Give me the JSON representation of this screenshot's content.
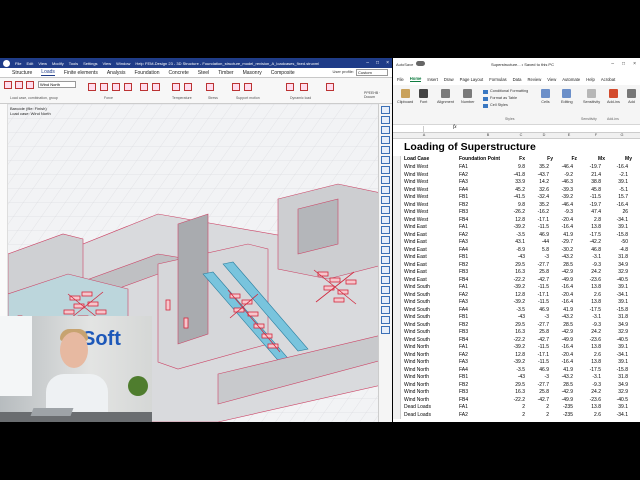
{
  "fem": {
    "title": "FEM-Design 23 - 3D Structure - Foundation_structure_model_revision_A_loadcases_fixed.struxml",
    "menu": [
      "File",
      "Edit",
      "View",
      "Modify",
      "Tools",
      "Settings",
      "View",
      "Window",
      "Help"
    ],
    "tabs": [
      "Structure",
      "Loads",
      "Finite elements",
      "Analysis",
      "Foundation",
      "Concrete",
      "Steel",
      "Timber",
      "Masonry",
      "Composite"
    ],
    "active_tab": "Loads",
    "user_profile_label": "User profile:",
    "user_profile_value": "Custom",
    "load_case_combo": "Wind North",
    "ribbon_groups": [
      "Load case, combination, group",
      "Force",
      "Temperature",
      "Stress",
      "Support motion",
      "Dynamic load"
    ],
    "info_line1": "Barcode (file: Finish)",
    "info_line2": "Load case: Wind North",
    "pp_label": "PPEEHB · Docum"
  },
  "webcam": {
    "logo_text": "Soft"
  },
  "excel": {
    "autosave_label": "AutoSave",
    "file_title": "Superstructure... • Saved to this PC",
    "tabs": [
      "File",
      "Home",
      "Insert",
      "Draw",
      "Page Layout",
      "Formulas",
      "Data",
      "Review",
      "View",
      "Automate",
      "Help",
      "Acrobat"
    ],
    "active_tab": "Home",
    "ribbon_buttons": [
      "Clipboard",
      "Font",
      "Alignment",
      "Number"
    ],
    "styles_items": [
      "Conditional Formatting",
      "Format as Table",
      "Cell Styles"
    ],
    "styles_group": "Styles",
    "ribbon_right": [
      "Cells",
      "Editing",
      "Sensitivity",
      "Add-ins",
      "Add"
    ],
    "ribbon_right_groups": [
      "Sensitivity",
      "Add-ins"
    ],
    "fx": "fx",
    "columns": [
      "A",
      "B",
      "C",
      "D",
      "E",
      "F",
      "G"
    ],
    "sheet_title": "Loading of Superstructure",
    "headers": [
      "Load Case",
      "Foundation Point",
      "Fx",
      "Fy",
      "Fz",
      "Mx",
      "My"
    ],
    "rows": [
      [
        "Wind West",
        "FA1",
        "9.8",
        "35.2",
        "-46.4",
        "-19.7",
        "-16.4"
      ],
      [
        "Wind West",
        "FA2",
        "-41.8",
        "-43.7",
        "-9.2",
        "21.4",
        "-2.1"
      ],
      [
        "Wind West",
        "FA3",
        "33.9",
        "14.2",
        "-46.3",
        "38.8",
        "39.1"
      ],
      [
        "Wind West",
        "FA4",
        "45.2",
        "32.6",
        "-39.3",
        "45.8",
        "-5.1"
      ],
      [
        "Wind West",
        "FB1",
        "-41.5",
        "-32.4",
        "-39.2",
        "-11.5",
        "15.7"
      ],
      [
        "Wind West",
        "FB2",
        "9.8",
        "35.2",
        "-46.4",
        "-19.7",
        "-16.4"
      ],
      [
        "Wind West",
        "FB3",
        "-26.2",
        "-16.2",
        "-9.3",
        "47.4",
        "26"
      ],
      [
        "Wind West",
        "FB4",
        "12.8",
        "-17.1",
        "-20.4",
        "2.8",
        "-34.1"
      ],
      [
        "Wind East",
        "FA1",
        "-39.2",
        "-11.5",
        "-16.4",
        "13.8",
        "39.1"
      ],
      [
        "Wind East",
        "FA2",
        "-3.5",
        "46.9",
        "41.9",
        "-17.5",
        "-15.8"
      ],
      [
        "Wind East",
        "FA3",
        "43.1",
        "-44",
        "-29.7",
        "-42.2",
        "-50"
      ],
      [
        "Wind East",
        "FA4",
        "-8.9",
        "5.8",
        "-30.2",
        "46.8",
        "-4.8"
      ],
      [
        "Wind East",
        "FB1",
        "-43",
        "-3",
        "-43.2",
        "-3.1",
        "31.8"
      ],
      [
        "Wind East",
        "FB2",
        "29.5",
        "-27.7",
        "28.5",
        "-9.3",
        "34.9"
      ],
      [
        "Wind East",
        "FB3",
        "16.3",
        "25.8",
        "-42.9",
        "24.2",
        "32.9"
      ],
      [
        "Wind East",
        "FB4",
        "-22.2",
        "-42.7",
        "-49.9",
        "-23.6",
        "-40.5"
      ],
      [
        "Wind South",
        "FA1",
        "-39.2",
        "-11.5",
        "-16.4",
        "13.8",
        "39.1"
      ],
      [
        "Wind South",
        "FA2",
        "12.8",
        "-17.1",
        "-20.4",
        "2.6",
        "-34.1"
      ],
      [
        "Wind South",
        "FA3",
        "-39.2",
        "-11.5",
        "-16.4",
        "13.8",
        "39.1"
      ],
      [
        "Wind South",
        "FA4",
        "-3.5",
        "46.9",
        "41.9",
        "-17.5",
        "-15.8"
      ],
      [
        "Wind South",
        "FB1",
        "-43",
        "-3",
        "-43.2",
        "-3.1",
        "31.8"
      ],
      [
        "Wind South",
        "FB2",
        "29.5",
        "-27.7",
        "28.5",
        "-9.3",
        "34.9"
      ],
      [
        "Wind South",
        "FB3",
        "16.3",
        "25.8",
        "-42.9",
        "24.2",
        "32.9"
      ],
      [
        "Wind South",
        "FB4",
        "-22.2",
        "-42.7",
        "-49.9",
        "-23.6",
        "-40.5"
      ],
      [
        "Wind North",
        "FA1",
        "-39.2",
        "-11.5",
        "-16.4",
        "13.8",
        "39.1"
      ],
      [
        "Wind North",
        "FA2",
        "12.8",
        "-17.1",
        "-20.4",
        "2.6",
        "-34.1"
      ],
      [
        "Wind North",
        "FA3",
        "-39.2",
        "-11.5",
        "-16.4",
        "13.8",
        "39.1"
      ],
      [
        "Wind North",
        "FA4",
        "-3.5",
        "46.9",
        "41.9",
        "-17.5",
        "-15.8"
      ],
      [
        "Wind North",
        "FB1",
        "-43",
        "-3",
        "-43.2",
        "-3.1",
        "31.8"
      ],
      [
        "Wind North",
        "FB2",
        "29.5",
        "-27.7",
        "28.5",
        "-9.3",
        "34.9"
      ],
      [
        "Wind North",
        "FB3",
        "16.3",
        "25.8",
        "-42.9",
        "24.2",
        "32.9"
      ],
      [
        "Wind North",
        "FB4",
        "-22.2",
        "-42.7",
        "-49.9",
        "-23.6",
        "-40.5"
      ],
      [
        "Dead Loads",
        "FA1",
        "2",
        "2",
        "-235",
        "13.8",
        "39.1"
      ],
      [
        "Dead Loads",
        "FA2",
        "2",
        "2",
        "-235",
        "2.6",
        "-34.1"
      ]
    ]
  }
}
